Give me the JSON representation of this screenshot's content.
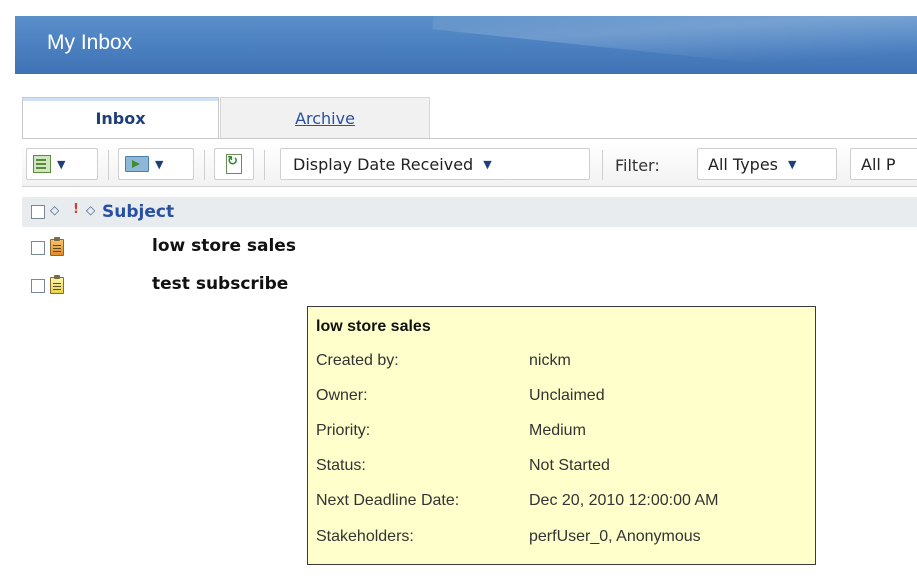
{
  "header": {
    "title": "My Inbox"
  },
  "tabs": [
    {
      "label": "Inbox",
      "active": true
    },
    {
      "label": "Archive",
      "active": false
    }
  ],
  "toolbar": {
    "new_icon": "new-task-icon",
    "move_icon": "move-folder-icon",
    "refresh_icon": "refresh-icon",
    "display_dropdown": "Display Date Received",
    "filter_label": "Filter:",
    "type_filter": "All Types",
    "second_filter": "All P"
  },
  "columns": {
    "subject": "Subject"
  },
  "rows": [
    {
      "subject": "low store sales",
      "icon": "task-orange-icon"
    },
    {
      "subject": "test subscribe",
      "icon": "task-yellow-icon"
    }
  ],
  "tooltip": {
    "title": "low store sales",
    "fields": [
      {
        "label": "Created by:",
        "value": "nickm"
      },
      {
        "label": "Owner:",
        "value": "Unclaimed"
      },
      {
        "label": "Priority:",
        "value": "Medium"
      },
      {
        "label": "Status:",
        "value": "Not Started"
      },
      {
        "label": "Next Deadline Date:",
        "value": "Dec 20, 2010 12:00:00 AM"
      },
      {
        "label": "Stakeholders:",
        "value": "perfUser_0, Anonymous"
      }
    ]
  },
  "colors": {
    "header_bg": "#4a7fc0",
    "tooltip_bg": "#ffffcc",
    "link": "#2850a0"
  }
}
